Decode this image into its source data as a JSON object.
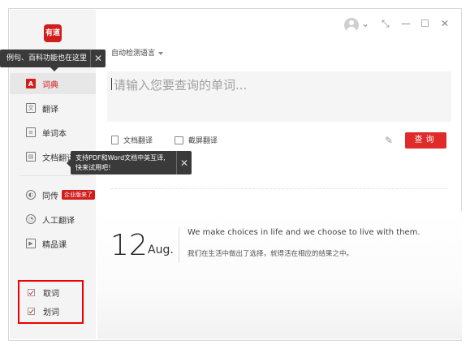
{
  "app": {
    "logo_text": "有道"
  },
  "tooltips": {
    "feature_tip": "例句、百科功能也在这里",
    "doc_tip_line1": "支持PDF和Word文档中英互译,",
    "doc_tip_line2": "快来试用吧！",
    "close_glyph": "✕"
  },
  "sidebar": {
    "items": [
      {
        "label": "词典",
        "icon": "A"
      },
      {
        "label": "翻译",
        "icon": "文"
      },
      {
        "label": "单词本",
        "icon": "≡"
      },
      {
        "label": "文档翻译",
        "icon": "▤"
      },
      {
        "label": "同传",
        "icon": "◐",
        "badge": "企业版来了"
      },
      {
        "label": "人工翻译",
        "icon": "◔"
      },
      {
        "label": "精品课",
        "icon": "▶"
      }
    ],
    "checks": [
      {
        "label": "取词",
        "checked": true
      },
      {
        "label": "划词",
        "checked": true
      }
    ]
  },
  "window_controls": {
    "chevron": "⌄",
    "compact": "⤡",
    "minimize": "—",
    "maximize": "☐",
    "close": "✕"
  },
  "translator": {
    "language_select": "自动检测语言",
    "search_placeholder": "请输入您要查询的单词...",
    "doc_translate": "文档翻译",
    "screenshot_translate": "截屏翻译",
    "query_button": "查询"
  },
  "daily": {
    "day": "12",
    "month": "Aug.",
    "sentence_en": "We make choices in life and we choose to live with them.",
    "sentence_cn": "我们在生活中做出了选择，就得活在相应的结果之中。"
  },
  "colors": {
    "accent": "#d21d1d",
    "sidebar_bg": "#f4f4f4",
    "tooltip_bg": "#3a3a3a"
  }
}
